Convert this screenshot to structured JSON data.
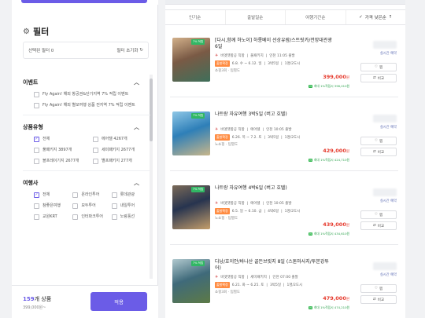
{
  "filter": {
    "title": "필터",
    "selected_label": "선택된 필터 0",
    "reset_label": "필터 초기화",
    "sections": {
      "event": {
        "title": "이벤트",
        "options": [
          {
            "label": "Fly Again! 해외 항공권&단기지역 7% 적립 이벤트",
            "checked": false
          },
          {
            "label": "Fly Again! 해외 별모여행 상품 전지역 7% 적립 이벤트",
            "checked": false
          }
        ]
      },
      "product_type": {
        "title": "상품유형",
        "options": [
          {
            "label": "전체",
            "checked": true
          },
          {
            "label": "에어텔 4267개",
            "checked": false
          },
          {
            "label": "풀패키지 3897개",
            "checked": false
          },
          {
            "label": "세미패키지 2677개",
            "checked": false
          },
          {
            "label": "블프레이기지 2677개",
            "checked": false
          },
          {
            "label": "별프패키지 277개",
            "checked": false
          }
        ]
      },
      "agency": {
        "title": "여행사",
        "options": [
          {
            "label": "전체",
            "checked": true
          },
          {
            "label": "온라인투어",
            "checked": false
          },
          {
            "label": "롯데관광",
            "checked": false
          },
          {
            "label": "참좋은여행",
            "checked": false
          },
          {
            "label": "모두투어",
            "checked": false
          },
          {
            "label": "내일투어",
            "checked": false
          },
          {
            "label": "교원KRT",
            "checked": false
          },
          {
            "label": "인터파크투어",
            "checked": false
          },
          {
            "label": "노랑풍선",
            "checked": false
          }
        ]
      }
    },
    "result_count": "159",
    "result_unit": "개 상품",
    "result_price": "399,000원~",
    "apply_label": "적용"
  },
  "sort": {
    "options": [
      "인기순",
      "출발일순",
      "여행기간순",
      "가격 낮은순"
    ]
  },
  "cards": [
    {
      "title": "[다시,함께 하노이] 하롱베이 선상유람/스트릿카/전망대관광 6일",
      "badge": "7% 적립",
      "airline": "비엣젯항공 직항",
      "country": "풀패키지",
      "departure": "인천 11:05 출발",
      "depart_badge": "출발확정",
      "dates": "6.8. 수 ~ 6.12. 일",
      "nights": "3박5일",
      "seats": "1명/2도시",
      "tags": "쇼핑3회 · 팁별도",
      "price": "399,000",
      "price_unit": "원",
      "discount": "최대 1%적립시 396,010원",
      "live": "실시간 예약",
      "btn1": "찜",
      "btn2": "비교",
      "thumb_colors": [
        "#7a5a45",
        "#d2b08a",
        "#3f6f5a"
      ]
    },
    {
      "title": "나트랑 자유여행 3박5일 (버고 호텔)",
      "badge": "7% 적립",
      "airline": "비엣젯항공 직항",
      "country": "에어텔",
      "departure": "인천 10:05 출발",
      "depart_badge": "출발확정",
      "dates": "6.26. 목 ~ 7.2. 토",
      "nights": "3박5일",
      "seats": "1명/2도시",
      "tags": "노쇼핑 · 팁별도",
      "price": "429,000",
      "price_unit": "원",
      "discount": "최대 1%적립시 424,710원",
      "live": "실시간 예약",
      "btn1": "찜",
      "btn2": "비교",
      "thumb_colors": [
        "#2e7fb8",
        "#8fc7e6",
        "#c8b68a"
      ]
    },
    {
      "title": "나트랑 자유여행 4박6일 (버고 호텔)",
      "badge": "7% 적립",
      "airline": "비엣젯항공 직항",
      "country": "에어텔",
      "departure": "인천 10:05 출발",
      "depart_badge": "출발확정",
      "dates": "6.5. 일 ~ 6.10. 금",
      "nights": "4박6일",
      "seats": "1명/2도시",
      "tags": "노쇼핑 · 팁별도",
      "price": "439,000",
      "price_unit": "원",
      "discount": "최대 1%적립시 434,610원",
      "live": "실시간 예약",
      "btn1": "찜",
      "btn2": "비교",
      "thumb_colors": [
        "#27344f",
        "#7b6a58",
        "#c49e6a"
      ]
    },
    {
      "title": "다낭/호이안/바나산 골든브릿지 8일 (스톤마사지/투본강투어)",
      "badge": "7% 적립",
      "airline": "비엣젯항공 직항",
      "country": "세미패키지",
      "departure": "인천 07:00 출발",
      "depart_badge": "출발확정",
      "dates": "6.21. 화 ~ 6.25. 토",
      "nights": "3박5일",
      "seats": "1명/2도시",
      "tags": "쇼핑3회 · 팁별도",
      "price": "479,000",
      "price_unit": "원",
      "discount": "최대 1%적립시 474,210원",
      "live": "실시간 예약",
      "btn1": "찜",
      "btn2": "비교",
      "thumb_colors": [
        "#3f6a7a",
        "#b1c9cf",
        "#5d7a46"
      ]
    }
  ]
}
